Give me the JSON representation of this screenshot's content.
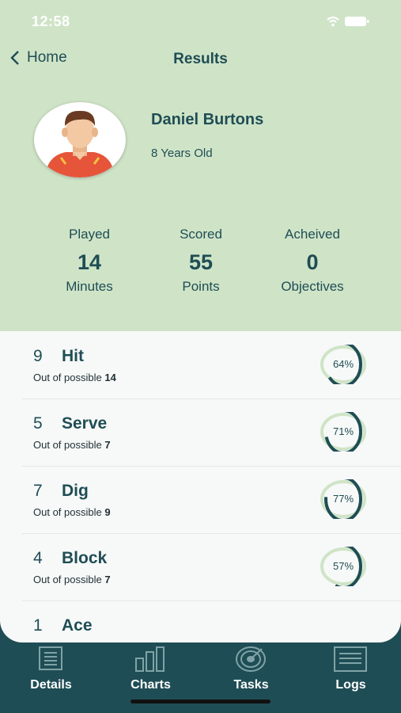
{
  "status_bar": {
    "time": "12:58"
  },
  "nav": {
    "back_label": "Home",
    "title": "Results"
  },
  "profile": {
    "name": "Daniel Burtons",
    "age": "8 Years Old"
  },
  "stats": [
    {
      "label": "Played",
      "value": "14",
      "unit": "Minutes"
    },
    {
      "label": "Scored",
      "value": "55",
      "unit": "Points"
    },
    {
      "label": "Acheived",
      "value": "0",
      "unit": "Objectives"
    }
  ],
  "skills": [
    {
      "count": "9",
      "name": "Hit",
      "sub_prefix": "Out of possible",
      "possible": "14",
      "percent_label": "64%",
      "percent": 64
    },
    {
      "count": "5",
      "name": "Serve",
      "sub_prefix": "Out of possible",
      "possible": "7",
      "percent_label": "71%",
      "percent": 71
    },
    {
      "count": "7",
      "name": "Dig",
      "sub_prefix": "Out of possible",
      "possible": "9",
      "percent_label": "77%",
      "percent": 77
    },
    {
      "count": "4",
      "name": "Block",
      "sub_prefix": "Out of possible",
      "possible": "7",
      "percent_label": "57%",
      "percent": 57
    },
    {
      "count": "1",
      "name": "Ace"
    }
  ],
  "tabs": [
    {
      "label": "Details",
      "icon": "details-icon"
    },
    {
      "label": "Charts",
      "icon": "charts-icon"
    },
    {
      "label": "Tasks",
      "icon": "target-icon"
    },
    {
      "label": "Logs",
      "icon": "logs-icon"
    }
  ],
  "colors": {
    "header_bg": "#cfe4c7",
    "primary": "#1f4d55",
    "ring_track": "#cfe4c7",
    "panel_bg": "#f7f9f8"
  }
}
